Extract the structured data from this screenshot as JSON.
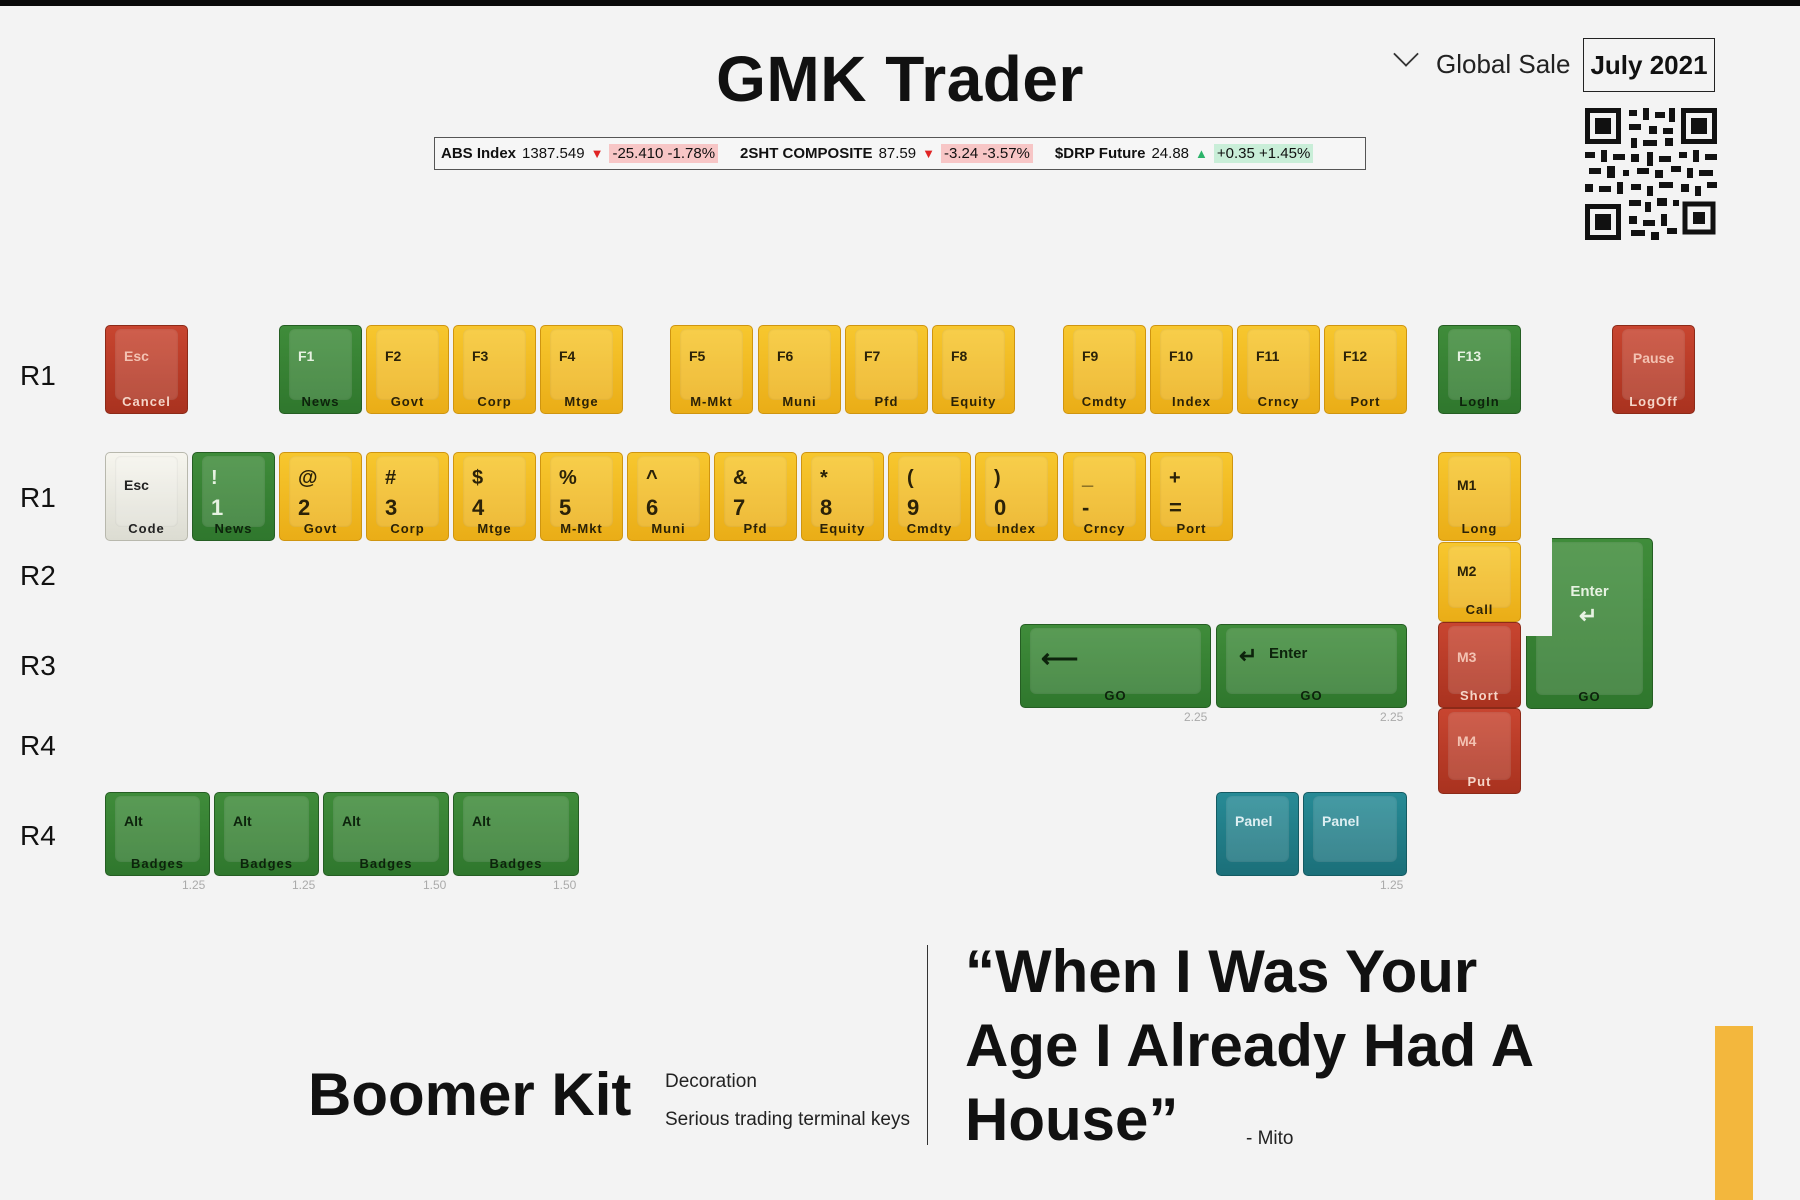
{
  "title": "GMK Trader",
  "ticker": [
    {
      "name": "ABS Index",
      "value": "1387.549",
      "direction": "down",
      "change": "-25.410 -1.78%"
    },
    {
      "name": "2SHT COMPOSITE",
      "value": "87.59",
      "direction": "down",
      "change": "-3.24 -3.57%"
    },
    {
      "name": "$DRP Future",
      "value": "24.88",
      "direction": "up",
      "change": "+0.35 +1.45%"
    }
  ],
  "header": {
    "region": "Global Sale",
    "date": "July 2021"
  },
  "row_labels": [
    "R1",
    "R1",
    "R2",
    "R3",
    "R4",
    "R4"
  ],
  "keys": {
    "esc_fn": {
      "top": "Esc",
      "bottom": "Cancel"
    },
    "f1": {
      "top": "F1",
      "bottom": "News"
    },
    "f2": {
      "top": "F2",
      "bottom": "Govt"
    },
    "f3": {
      "top": "F3",
      "bottom": "Corp"
    },
    "f4": {
      "top": "F4",
      "bottom": "Mtge"
    },
    "f5": {
      "top": "F5",
      "bottom": "M-Mkt"
    },
    "f6": {
      "top": "F6",
      "bottom": "Muni"
    },
    "f7": {
      "top": "F7",
      "bottom": "Pfd"
    },
    "f8": {
      "top": "F8",
      "bottom": "Equity"
    },
    "f9": {
      "top": "F9",
      "bottom": "Cmdty"
    },
    "f10": {
      "top": "F10",
      "bottom": "Index"
    },
    "f11": {
      "top": "F11",
      "bottom": "Crncy"
    },
    "f12": {
      "top": "F12",
      "bottom": "Port"
    },
    "f13": {
      "top": "F13",
      "bottom": "LogIn"
    },
    "pause": {
      "top": "Pause",
      "bottom": "LogOff"
    },
    "esc_num": {
      "top": "Esc",
      "bottom": "Code"
    },
    "n1": {
      "shift": "!",
      "main": "1",
      "bottom": "News"
    },
    "n2": {
      "shift": "@",
      "main": "2",
      "bottom": "Govt"
    },
    "n3": {
      "shift": "#",
      "main": "3",
      "bottom": "Corp"
    },
    "n4": {
      "shift": "$",
      "main": "4",
      "bottom": "Mtge"
    },
    "n5": {
      "shift": "%",
      "main": "5",
      "bottom": "M-Mkt"
    },
    "n6": {
      "shift": "^",
      "main": "6",
      "bottom": "Muni"
    },
    "n7": {
      "shift": "&",
      "main": "7",
      "bottom": "Pfd"
    },
    "n8": {
      "shift": "*",
      "main": "8",
      "bottom": "Equity"
    },
    "n9": {
      "shift": "(",
      "main": "9",
      "bottom": "Cmdty"
    },
    "n0": {
      "shift": ")",
      "main": "0",
      "bottom": "Index"
    },
    "minus": {
      "shift": "_",
      "main": "-",
      "bottom": "Crncy"
    },
    "equal": {
      "shift": "+",
      "main": "=",
      "bottom": "Port"
    },
    "m1": {
      "top": "M1",
      "bottom": "Long"
    },
    "m2": {
      "top": "M2",
      "bottom": "Call"
    },
    "m3": {
      "top": "M3",
      "bottom": "Short"
    },
    "m4": {
      "top": "M4",
      "bottom": "Put"
    },
    "enter_iso": {
      "top": "Enter",
      "bottom": "GO"
    },
    "backspace": {
      "bottom": "GO"
    },
    "enter_225": {
      "top": "Enter",
      "bottom": "GO"
    },
    "alt1": {
      "top": "Alt",
      "bottom": "Badges"
    },
    "alt2": {
      "top": "Alt",
      "bottom": "Badges"
    },
    "alt3": {
      "top": "Alt",
      "bottom": "Badges"
    },
    "alt4": {
      "top": "Alt",
      "bottom": "Badges"
    },
    "panel1": {
      "top": "Panel"
    },
    "panel2": {
      "top": "Panel"
    }
  },
  "size_notes": {
    "backspace": "2.25",
    "enter": "2.25",
    "alt1": "1.25",
    "alt2": "1.25",
    "alt3": "1.50",
    "alt4": "1.50",
    "panel": "1.25"
  },
  "kit": {
    "name": "Boomer Kit",
    "type": "Decoration",
    "description": "Serious trading terminal keys"
  },
  "quote": {
    "text": "“When I Was Your Age I Already Had A House”",
    "author": "- Mito"
  },
  "colors": {
    "red": "#b83a26",
    "green": "#37822f",
    "yellow": "#f2bb22",
    "white": "#ecebe3",
    "teal": "#217d88",
    "accent": "#f3b73d"
  }
}
